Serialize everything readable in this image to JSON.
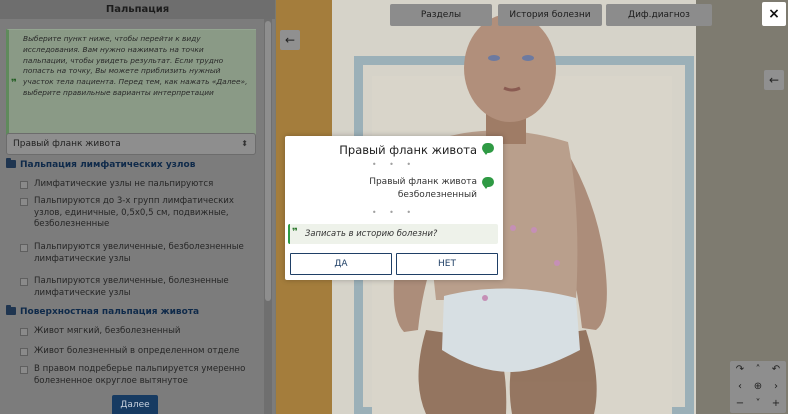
{
  "left_panel": {
    "title": "Пальпация",
    "instruction": "Выберите пункт ниже, чтобы перейти к виду исследования. Вам нужно нажимать на точки пальпации, чтобы увидеть результат. Если трудно попасть на точку, Вы можете приблизить нужный участок тела пациента. Перед тем, как нажать «Далее», выберите правильные варианты интерпретации",
    "quote_glyph": "❞",
    "select_value": "Правый фланк живота",
    "select_arrows": "⬍",
    "groups": [
      {
        "title": "Пальпация лимфатических узлов",
        "options": [
          "Лимфатические узлы не пальпируются",
          "Пальпируются до 3-х групп лимфатических узлов, единичные, 0,5х0,5 см, подвижные, безболезненные",
          "Пальпируются увеличенные, безболезненные лимфатические узлы",
          "Пальпируются увеличенные, болезненные лимфатические узлы"
        ]
      },
      {
        "title": "Поверхностная пальпация живота",
        "options": [
          "Живот мягкий, безболезненный",
          "Живот болезненный в определенном отделе",
          "В правом подреберье пальпируется умеренно болезненное округлое вытянутое"
        ]
      }
    ],
    "next_label": "Далее"
  },
  "viewport": {
    "tabs": [
      "Разделы",
      "История болезни",
      "Диф.диагноз"
    ],
    "back_glyph": "←",
    "close_glyph": "×",
    "nav_glyphs": {
      "rotate_right": "↷",
      "up": "˄",
      "rotate_left": "↶",
      "left": "‹",
      "center": "⊕",
      "right": "›",
      "zoom_out": "−",
      "down": "˅",
      "zoom_in": "+"
    }
  },
  "dialog": {
    "title": "Правый фланк живота",
    "result": "Правый фланк живота безболезненный",
    "dots": "• • •",
    "question_glyph": "❞",
    "question": "Записать в историю болезни?",
    "yes_label": "ДА",
    "no_label": "НЕТ"
  },
  "colors": {
    "accent_green": "#2f9a44",
    "button_navy": "#173b62",
    "dialog_button_border": "#1f3f66"
  }
}
